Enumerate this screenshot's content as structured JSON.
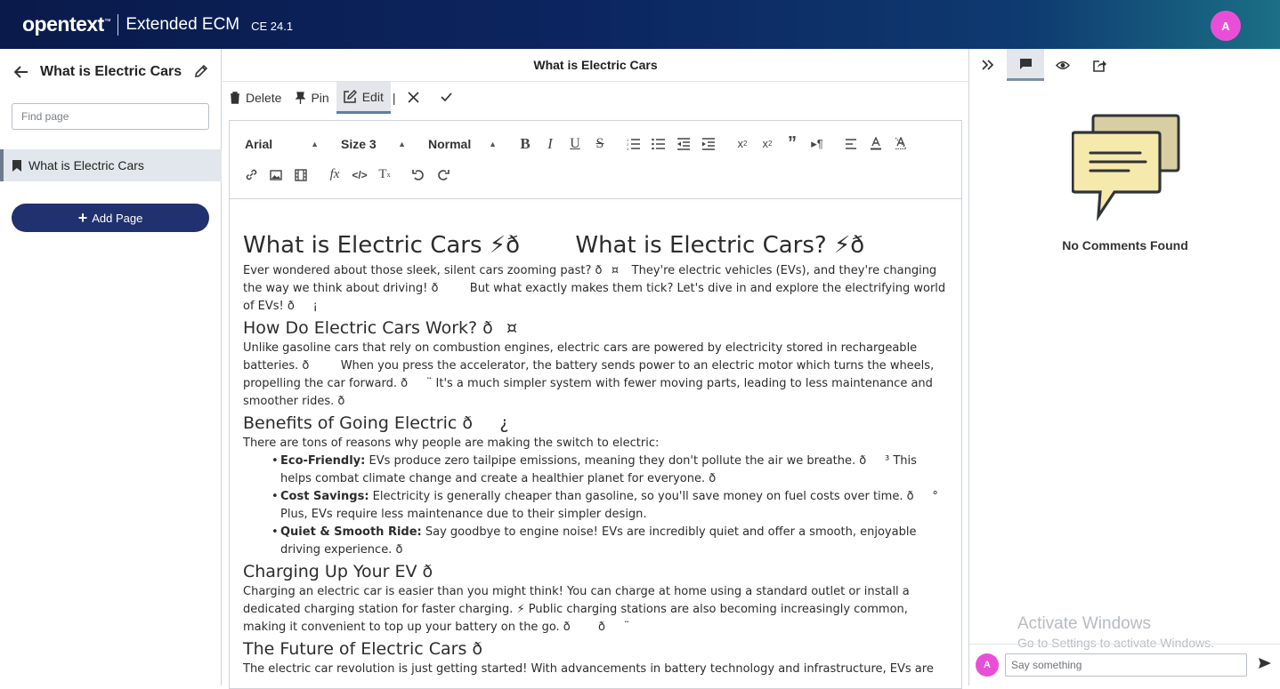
{
  "header": {
    "brand": "opentext",
    "brand_tm": "™",
    "product": "Extended ECM",
    "version": "CE 24.1",
    "avatar_initial": "A"
  },
  "sidebar": {
    "title": "What is Electric Cars",
    "search_placeholder": "Find page",
    "items": [
      {
        "label": "What is Electric Cars"
      }
    ],
    "add_page_label": "Add Page"
  },
  "main": {
    "title": "What is Electric Cars",
    "toolbar": {
      "delete_label": "Delete",
      "pin_label": "Pin",
      "edit_label": "Edit",
      "separator": "|"
    },
    "editor_toolbar": {
      "font": "Arial",
      "size": "Size 3",
      "style": "Normal"
    },
    "content": {
      "h1": "What is Electric Cars ⚡ðWhat is Electric Cars? ⚡ð",
      "intro": "Ever wondered about those sleek, silent cars zooming past? ð¤ They're electric vehicles (EVs), and they're changing the way we think about driving! ð But what exactly makes them tick? Let's dive in and explore the electrifying world of EVs! ð¡",
      "h2_how": "How Do Electric Cars Work? ð¤",
      "how_text": "Unlike gasoline cars that rely on combustion engines, electric cars are powered by electricity stored in rechargeable batteries. ð When you press the accelerator, the battery sends power to an electric motor which turns the wheels, propelling the car forward. ð¨ It's a much simpler system with fewer moving parts, leading to less maintenance and smoother rides. ð",
      "h2_benefits": "Benefits of Going Electric ð¿",
      "benefits_intro": "There are tons of reasons why people are making the switch to electric:",
      "benefits": [
        {
          "title": "Eco-Friendly:",
          "text": " EVs produce zero tailpipe emissions, meaning they don't pollute the air we breathe. ð³ This helps combat climate change and create a healthier planet for everyone. ð"
        },
        {
          "title": "Cost Savings:",
          "text": " Electricity is generally cheaper than gasoline, so you'll save money on fuel costs over time. ð° Plus, EVs require less maintenance due to their simpler design."
        },
        {
          "title": "Quiet & Smooth Ride:",
          "text": " Say goodbye to engine noise! EVs are incredibly quiet and offer a smooth, enjoyable driving experience. ð"
        }
      ],
      "h2_charging": "Charging Up Your EV ð",
      "charging_text": "Charging an electric car is easier than you might think! You can charge at home using a standard outlet or install a dedicated charging station for faster charging. ⚡ Public charging stations are also becoming increasingly common, making it convenient to top up your battery on the go. ðð¨",
      "h2_future": "The Future of Electric Cars ð",
      "future_text": "The electric car revolution is just getting started! With advancements in battery technology and infrastructure, EVs are"
    }
  },
  "right_panel": {
    "no_comments": "No Comments Found",
    "watermark_title": "Activate Windows",
    "watermark_sub": "Go to Settings to activate Windows.",
    "comment_placeholder": "Say something",
    "avatar_initial": "A"
  },
  "colors": {
    "accent": "#21306e",
    "avatar": "#e94fd6",
    "tab_indicator": "#5c7fa3"
  }
}
